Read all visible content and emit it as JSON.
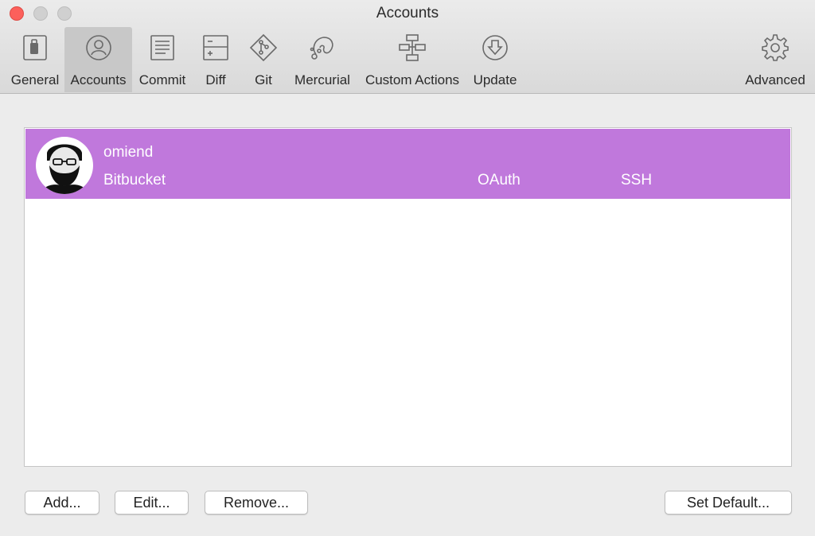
{
  "window": {
    "title": "Accounts"
  },
  "toolbar": {
    "items": [
      {
        "label": "General",
        "icon": "toggle-switch-icon"
      },
      {
        "label": "Accounts",
        "icon": "user-circle-icon",
        "selected": true
      },
      {
        "label": "Commit",
        "icon": "document-lines-icon"
      },
      {
        "label": "Diff",
        "icon": "diff-icon"
      },
      {
        "label": "Git",
        "icon": "git-diamond-icon"
      },
      {
        "label": "Mercurial",
        "icon": "mercurial-icon"
      },
      {
        "label": "Custom Actions",
        "icon": "flowchart-icon"
      },
      {
        "label": "Update",
        "icon": "download-circle-icon"
      },
      {
        "label": "Advanced",
        "icon": "gear-icon"
      }
    ]
  },
  "accounts": [
    {
      "username": "omiend",
      "host": "Bitbucket",
      "auth": "OAuth",
      "protocol": "SSH",
      "selected": true
    }
  ],
  "buttons": {
    "add": "Add...",
    "edit": "Edit...",
    "remove": "Remove...",
    "set_default": "Set Default..."
  },
  "colors": {
    "selection": "#c078dc",
    "close_button": "#fc605b"
  }
}
